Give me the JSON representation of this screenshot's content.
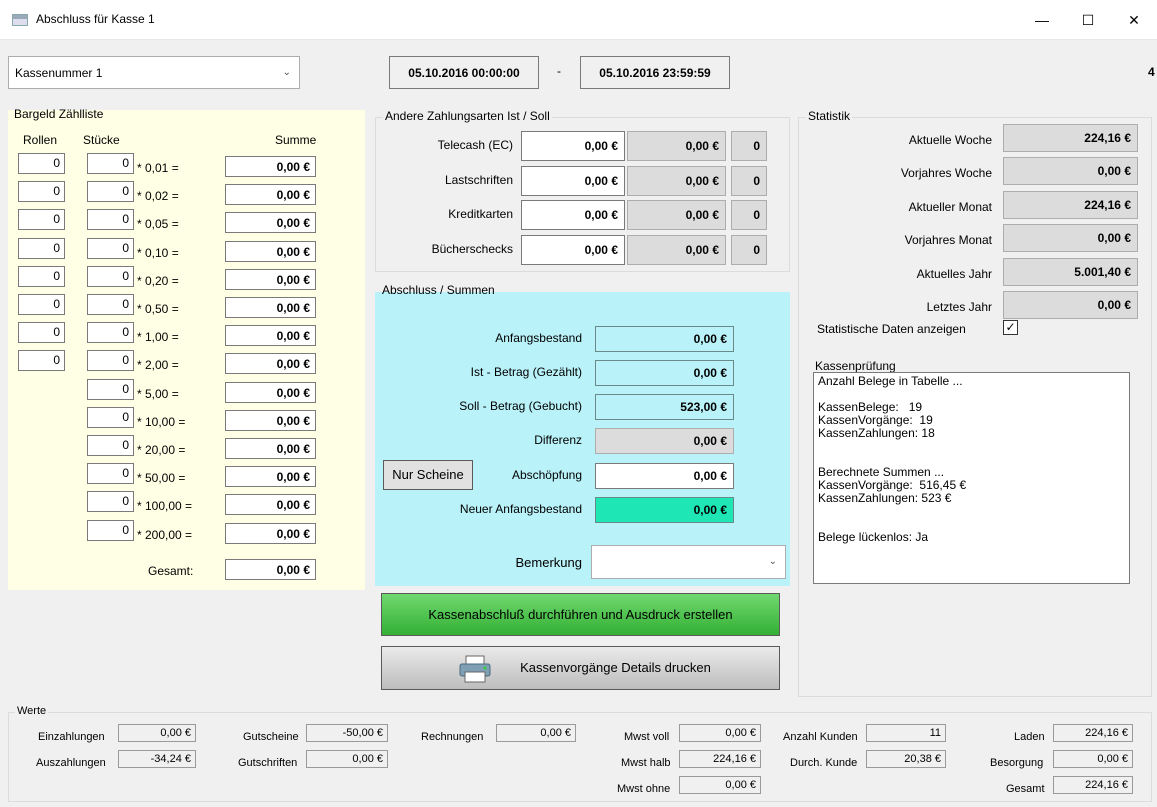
{
  "window": {
    "title": "Abschluss für Kasse 1",
    "minimize": "—",
    "maximize": "☐",
    "close": "✕"
  },
  "header": {
    "kasse": "Kassenummer 1",
    "date_from": "05.10.2016 00:00:00",
    "sep": "-",
    "date_to": "05.10.2016 23:59:59",
    "right_value": "4"
  },
  "bargeld": {
    "title": "Bargeld Zählliste",
    "col_rollen": "Rollen",
    "col_stuecke": "Stücke",
    "col_summe": "Summe",
    "rows": [
      {
        "rollen": "0",
        "stuecke": "0",
        "factor": "* 0,01 =",
        "summe": "0,00 €"
      },
      {
        "rollen": "0",
        "stuecke": "0",
        "factor": "* 0,02 =",
        "summe": "0,00 €"
      },
      {
        "rollen": "0",
        "stuecke": "0",
        "factor": "* 0,05 =",
        "summe": "0,00 €"
      },
      {
        "rollen": "0",
        "stuecke": "0",
        "factor": "* 0,10 =",
        "summe": "0,00 €"
      },
      {
        "rollen": "0",
        "stuecke": "0",
        "factor": "* 0,20 =",
        "summe": "0,00 €"
      },
      {
        "rollen": "0",
        "stuecke": "0",
        "factor": "* 0,50 =",
        "summe": "0,00 €"
      },
      {
        "rollen": "0",
        "stuecke": "0",
        "factor": "* 1,00 =",
        "summe": "0,00 €"
      },
      {
        "rollen": "0",
        "stuecke": "0",
        "factor": "* 2,00 =",
        "summe": "0,00 €"
      },
      {
        "stuecke": "0",
        "factor": "* 5,00 =",
        "summe": "0,00 €"
      },
      {
        "stuecke": "0",
        "factor": "* 10,00 =",
        "summe": "0,00 €"
      },
      {
        "stuecke": "0",
        "factor": "* 20,00 =",
        "summe": "0,00 €"
      },
      {
        "stuecke": "0",
        "factor": "* 50,00 =",
        "summe": "0,00 €"
      },
      {
        "stuecke": "0",
        "factor": "* 100,00 =",
        "summe": "0,00 €"
      },
      {
        "stuecke": "0",
        "factor": "* 200,00 =",
        "summe": "0,00 €"
      }
    ],
    "gesamt_label": "Gesamt:",
    "gesamt_value": "0,00 €"
  },
  "zahlungsarten": {
    "title": "Andere Zahlungsarten Ist / Soll",
    "rows": [
      {
        "label": "Telecash (EC)",
        "ist": "0,00 €",
        "soll": "0,00 €",
        "count": "0"
      },
      {
        "label": "Lastschriften",
        "ist": "0,00 €",
        "soll": "0,00 €",
        "count": "0"
      },
      {
        "label": "Kreditkarten",
        "ist": "0,00 €",
        "soll": "0,00 €",
        "count": "0"
      },
      {
        "label": "Bücherschecks",
        "ist": "0,00 €",
        "soll": "0,00 €",
        "count": "0"
      }
    ]
  },
  "abschluss": {
    "title": "Abschluss / Summen",
    "anfangsbestand_label": "Anfangsbestand",
    "anfangsbestand": "0,00 €",
    "ist_label": "Ist - Betrag (Gezählt)",
    "ist": "0,00 €",
    "soll_label": "Soll - Betrag (Gebucht)",
    "soll": "523,00 €",
    "differenz_label": "Differenz",
    "differenz": "0,00 €",
    "nur_scheine": "Nur Scheine",
    "abschoepfung_label": "Abschöpfung",
    "abschoepfung": "0,00 €",
    "neuer_label": "Neuer Anfangsbestand",
    "neuer": "0,00 €",
    "bemerkung_label": "Bemerkung",
    "bemerkung": ""
  },
  "buttons": {
    "abschluss": "Kassenabschluß durchführen und Ausdruck erstellen",
    "details": "Kassenvorgänge Details drucken"
  },
  "statistik": {
    "title": "Statistik",
    "rows": [
      {
        "label": "Aktuelle Woche",
        "value": "224,16 €"
      },
      {
        "label": "Vorjahres Woche",
        "value": "0,00 €"
      },
      {
        "label": "Aktueller Monat",
        "value": "224,16 €"
      },
      {
        "label": "Vorjahres Monat",
        "value": "0,00 €"
      },
      {
        "label": "Aktuelles Jahr",
        "value": "5.001,40 €"
      },
      {
        "label": "Letztes Jahr",
        "value": "0,00 €"
      }
    ],
    "show_label": "Statistische Daten anzeigen",
    "show_checked": true
  },
  "pruefung": {
    "title": "Kassenprüfung",
    "text": "Anzahl Belege in Tabelle ...\n\nKassenBelege:   19\nKassenVorgänge:  19\nKassenZahlungen: 18\n\n\nBerechnete Summen ...\nKassenVorgänge:  516,45 €\nKassenZahlungen: 523 €\n\n\nBelege lückenlos: Ja"
  },
  "werte": {
    "title": "Werte",
    "einzahlungen_label": "Einzahlungen",
    "einzahlungen": "0,00 €",
    "auszahlungen_label": "Auszahlungen",
    "auszahlungen": "-34,24 €",
    "gutscheine_label": "Gutscheine",
    "gutscheine": "-50,00 €",
    "gutschriften_label": "Gutschriften",
    "gutschriften": "0,00 €",
    "rechnungen_label": "Rechnungen",
    "rechnungen": "0,00 €",
    "mwst_voll_label": "Mwst voll",
    "mwst_voll": "0,00 €",
    "mwst_halb_label": "Mwst halb",
    "mwst_halb": "224,16 €",
    "mwst_ohne_label": "Mwst ohne",
    "mwst_ohne": "0,00 €",
    "kunden_label": "Anzahl Kunden",
    "kunden": "11",
    "durch_label": "Durch. Kunde",
    "durch": "20,38 €",
    "laden_label": "Laden",
    "laden": "224,16 €",
    "besorgung_label": "Besorgung",
    "besorgung": "0,00 €",
    "gesamt_label": "Gesamt",
    "gesamt": "224,16 €"
  },
  "colors": {
    "yellow_panel": "#ffffe6",
    "cyan_panel": "#b9f2f9",
    "green_button": "#4cc44c",
    "neuer_highlight": "#1ee6b4"
  }
}
